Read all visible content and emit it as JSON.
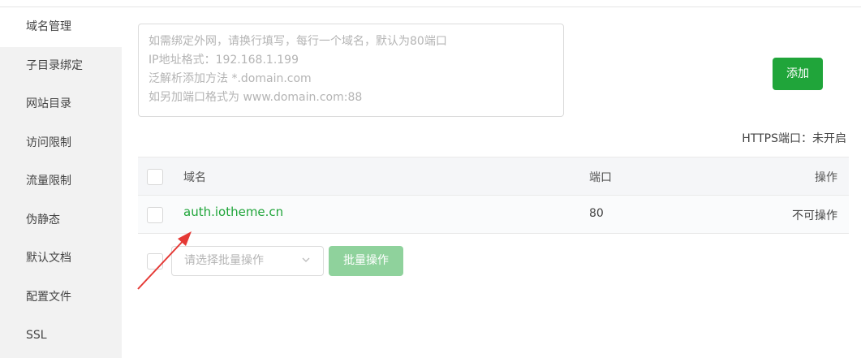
{
  "sidebar": {
    "items": [
      {
        "label": "域名管理"
      },
      {
        "label": "子目录绑定"
      },
      {
        "label": "网站目录"
      },
      {
        "label": "访问限制"
      },
      {
        "label": "流量限制"
      },
      {
        "label": "伪静态"
      },
      {
        "label": "默认文档"
      },
      {
        "label": "配置文件"
      },
      {
        "label": "SSL"
      }
    ]
  },
  "domain_form": {
    "placeholder": "如需绑定外网，请换行填写，每行一个域名，默认为80端口\nIP地址格式：192.168.1.199\n泛解析添加方法 *.domain.com\n如另加端口格式为 www.domain.com:88",
    "add_label": "添加"
  },
  "https_status": "HTTPS端口：未开启",
  "table": {
    "headers": {
      "name": "域名",
      "port": "端口",
      "op": "操作"
    },
    "rows": [
      {
        "domain": "auth.iotheme.cn",
        "port": "80",
        "op": "不可操作"
      }
    ]
  },
  "batch": {
    "select_placeholder": "请选择批量操作",
    "button_label": "批量操作"
  },
  "colors": {
    "accent": "#20a53a",
    "arrow": "#e53935"
  }
}
